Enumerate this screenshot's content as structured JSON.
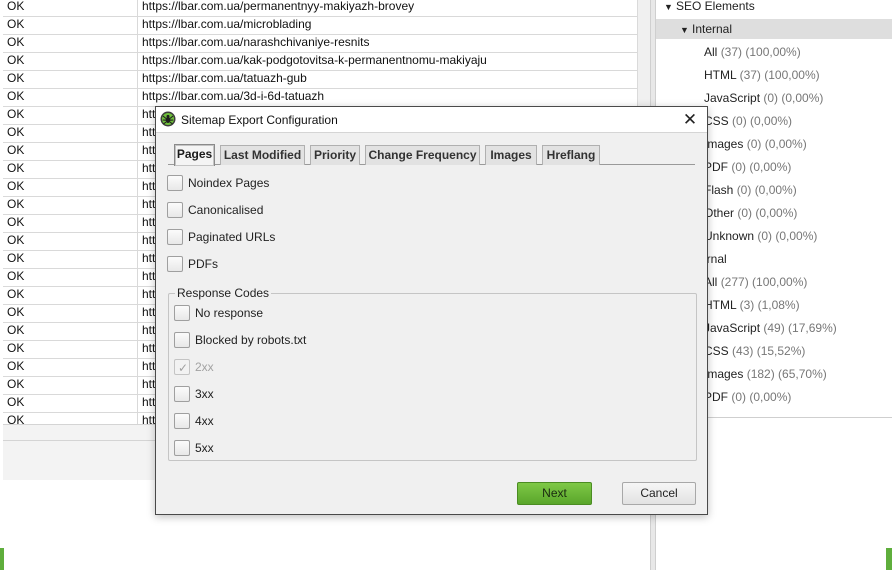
{
  "table": {
    "rows": [
      {
        "status": "OK",
        "url": "https://lbar.com.ua/permanentnyy-makiyazh-brovey"
      },
      {
        "status": "OK",
        "url": "https://lbar.com.ua/microblading"
      },
      {
        "status": "OK",
        "url": "https://lbar.com.ua/narashchivaniye-resnits"
      },
      {
        "status": "OK",
        "url": "https://lbar.com.ua/kak-podgotovitsa-k-permanentnomu-makiyaju"
      },
      {
        "status": "OK",
        "url": "https://lbar.com.ua/tatuazh-gub"
      },
      {
        "status": "OK",
        "url": "https://lbar.com.ua/3d-i-6d-tatuazh"
      },
      {
        "status": "OK",
        "url": "htt"
      },
      {
        "status": "OK",
        "url": "htt"
      },
      {
        "status": "OK",
        "url": "htt"
      },
      {
        "status": "OK",
        "url": "htt"
      },
      {
        "status": "OK",
        "url": "htt"
      },
      {
        "status": "OK",
        "url": "htt"
      },
      {
        "status": "OK",
        "url": "htt"
      },
      {
        "status": "OK",
        "url": "htt"
      },
      {
        "status": "OK",
        "url": "htt"
      },
      {
        "status": "OK",
        "url": "htt"
      },
      {
        "status": "OK",
        "url": "htt"
      },
      {
        "status": "OK",
        "url": "htt"
      },
      {
        "status": "OK",
        "url": "htt"
      },
      {
        "status": "OK",
        "url": "htt"
      },
      {
        "status": "OK",
        "url": "htt"
      },
      {
        "status": "OK",
        "url": "htt"
      },
      {
        "status": "OK",
        "url": "htt"
      },
      {
        "status": "OK",
        "url": "htt"
      }
    ]
  },
  "tree": {
    "nodes": [
      {
        "arrow": "▼",
        "label": "SEO Elements",
        "count": "",
        "selected": false
      },
      {
        "arrow": "▼",
        "label": "Internal",
        "count": "",
        "selected": true
      },
      {
        "arrow": "",
        "label": "All",
        "count": "(37) (100,00%)",
        "selected": false
      },
      {
        "arrow": "",
        "label": "HTML",
        "count": "(37) (100,00%)",
        "selected": false
      },
      {
        "arrow": "",
        "label": "JavaScript",
        "count": "(0) (0,00%)",
        "selected": false
      },
      {
        "arrow": "",
        "label": "CSS",
        "count": "(0) (0,00%)",
        "selected": false
      },
      {
        "arrow": "",
        "label": "Images",
        "count": "(0) (0,00%)",
        "selected": false
      },
      {
        "arrow": "",
        "label": "PDF",
        "count": "(0) (0,00%)",
        "selected": false
      },
      {
        "arrow": "",
        "label": "Flash",
        "count": "(0) (0,00%)",
        "selected": false
      },
      {
        "arrow": "",
        "label": "Other",
        "count": "(0) (0,00%)",
        "selected": false
      },
      {
        "arrow": "",
        "label": "Unknown",
        "count": "(0) (0,00%)",
        "selected": false
      },
      {
        "arrow": "",
        "label": "ernal",
        "count": "",
        "selected": false
      },
      {
        "arrow": "",
        "label": "All",
        "count": "(277) (100,00%)",
        "selected": false
      },
      {
        "arrow": "",
        "label": "HTML",
        "count": "(3) (1,08%)",
        "selected": false
      },
      {
        "arrow": "",
        "label": "JavaScript",
        "count": "(49) (17,69%)",
        "selected": false
      },
      {
        "arrow": "",
        "label": "CSS",
        "count": "(43) (15,52%)",
        "selected": false
      },
      {
        "arrow": "",
        "label": "Images",
        "count": "(182) (65,70%)",
        "selected": false
      },
      {
        "arrow": "",
        "label": "PDF",
        "count": "(0) (0,00%)",
        "selected": false
      }
    ]
  },
  "dialog": {
    "title": "Sitemap Export Configuration",
    "close_glyph": "✕",
    "tabs": [
      {
        "label": "Pages",
        "active": true
      },
      {
        "label": "Last Modified",
        "active": false
      },
      {
        "label": "Priority",
        "active": false
      },
      {
        "label": "Change Frequency",
        "active": false
      },
      {
        "label": "Images",
        "active": false
      },
      {
        "label": "Hreflang",
        "active": false
      }
    ],
    "page_options": [
      {
        "label": "Noindex Pages",
        "checked": false
      },
      {
        "label": "Canonicalised",
        "checked": false
      },
      {
        "label": "Paginated URLs",
        "checked": false
      },
      {
        "label": "PDFs",
        "checked": false
      }
    ],
    "response_codes": {
      "legend": "Response Codes",
      "options": [
        {
          "label": "No response",
          "checked": false,
          "disabled": false
        },
        {
          "label": "Blocked by robots.txt",
          "checked": false,
          "disabled": false
        },
        {
          "label": "2xx",
          "checked": true,
          "disabled": true
        },
        {
          "label": "3xx",
          "checked": false,
          "disabled": false
        },
        {
          "label": "4xx",
          "checked": false,
          "disabled": false
        },
        {
          "label": "5xx",
          "checked": false,
          "disabled": false
        }
      ]
    },
    "next_label": "Next",
    "cancel_label": "Cancel"
  },
  "colors": {
    "accent_green": "#5aa62b",
    "selected_row": "#dedede"
  },
  "icons": {
    "app": "spider-icon",
    "close": "close-icon",
    "expand": "triangle-down-icon",
    "check": "check-icon"
  }
}
